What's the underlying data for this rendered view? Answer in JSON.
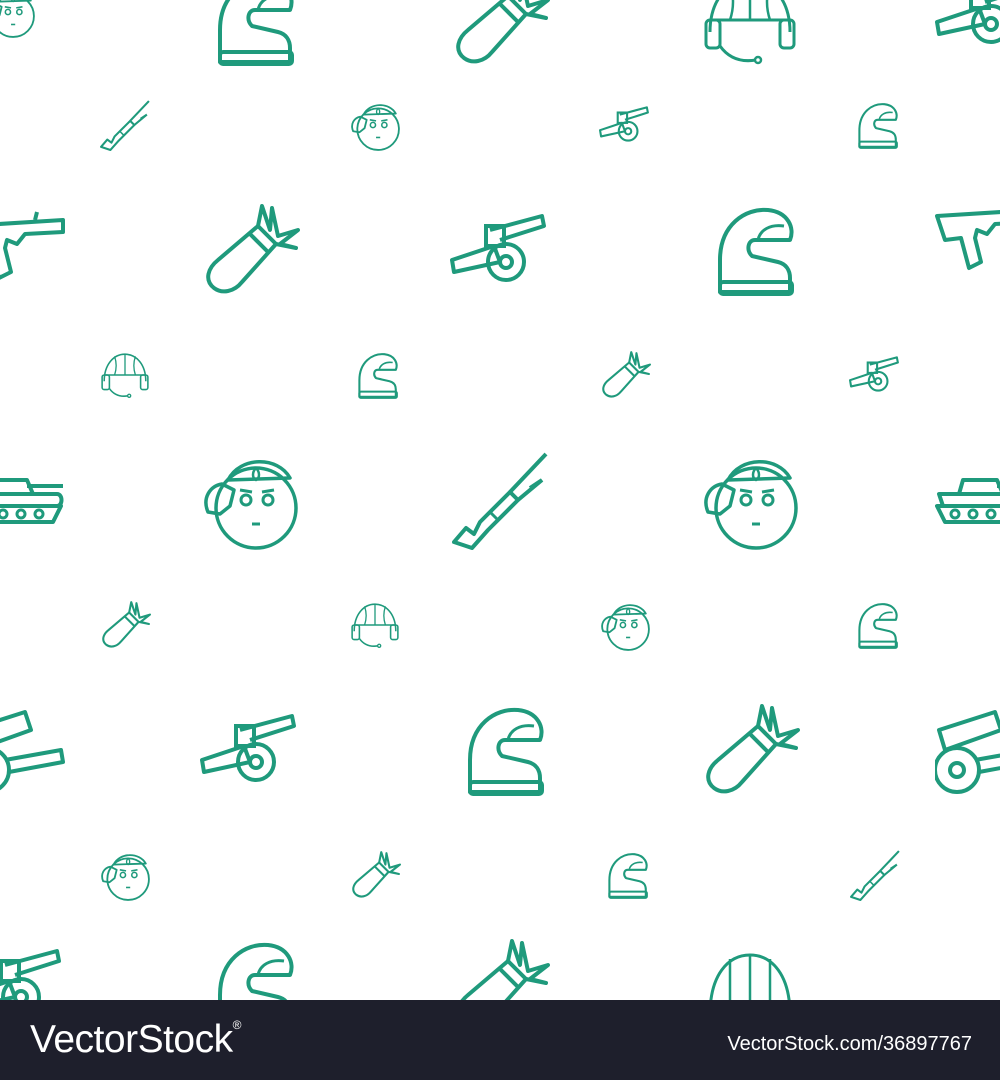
{
  "pattern": {
    "stroke_color": "#1f9a7c",
    "background": "#ffffff",
    "icons": [
      {
        "icon": "soldier-salute-icon",
        "scale": "small"
      },
      {
        "icon": "motorcycle-helmet-icon",
        "scale": "large"
      },
      {
        "icon": "bomb-icon",
        "scale": "large"
      },
      {
        "icon": "pilot-helmet-icon",
        "scale": "large"
      },
      {
        "icon": "cannon-icon",
        "scale": "large"
      },
      {
        "icon": "rifle-icon",
        "scale": "small"
      },
      {
        "icon": "soldier-salute-icon",
        "scale": "small"
      },
      {
        "icon": "cannon-icon",
        "scale": "small"
      },
      {
        "icon": "motorcycle-helmet-icon",
        "scale": "small"
      },
      {
        "icon": "assault-rifle-icon",
        "scale": "large"
      },
      {
        "icon": "bomb-icon",
        "scale": "large"
      },
      {
        "icon": "cannon-icon",
        "scale": "large"
      },
      {
        "icon": "motorcycle-helmet-icon",
        "scale": "large"
      },
      {
        "icon": "assault-rifle-icon",
        "scale": "large"
      },
      {
        "icon": "pilot-helmet-icon",
        "scale": "small"
      },
      {
        "icon": "motorcycle-helmet-icon",
        "scale": "small"
      },
      {
        "icon": "bomb-icon",
        "scale": "small"
      },
      {
        "icon": "cannon-icon",
        "scale": "small"
      },
      {
        "icon": "tank-icon",
        "scale": "large"
      },
      {
        "icon": "soldier-salute-icon",
        "scale": "large"
      },
      {
        "icon": "rifle-icon",
        "scale": "large"
      },
      {
        "icon": "soldier-salute-icon",
        "scale": "large"
      },
      {
        "icon": "tank-icon",
        "scale": "large"
      },
      {
        "icon": "bomb-icon",
        "scale": "small"
      },
      {
        "icon": "pilot-helmet-icon",
        "scale": "small"
      },
      {
        "icon": "soldier-salute-icon",
        "scale": "small"
      },
      {
        "icon": "motorcycle-helmet-icon",
        "scale": "small"
      },
      {
        "icon": "field-gun-icon",
        "scale": "large"
      },
      {
        "icon": "cannon-icon",
        "scale": "large"
      },
      {
        "icon": "motorcycle-helmet-icon",
        "scale": "large"
      },
      {
        "icon": "bomb-icon",
        "scale": "large"
      },
      {
        "icon": "field-gun-icon",
        "scale": "large"
      },
      {
        "icon": "soldier-salute-icon",
        "scale": "small"
      },
      {
        "icon": "bomb-icon",
        "scale": "small"
      },
      {
        "icon": "motorcycle-helmet-icon",
        "scale": "small"
      },
      {
        "icon": "rifle-icon",
        "scale": "small"
      },
      {
        "icon": "cannon-icon",
        "scale": "large"
      },
      {
        "icon": "motorcycle-helmet-icon",
        "scale": "large"
      },
      {
        "icon": "bomb-icon",
        "scale": "large"
      },
      {
        "icon": "hard-hat-icon",
        "scale": "large"
      }
    ]
  },
  "footer": {
    "brand_vector": "Vector",
    "brand_stock": "Stock",
    "brand_reg": "®",
    "image_id": "VectorStock.com/36897767",
    "background": "#1e1f2c",
    "text_color": "#ffffff"
  }
}
